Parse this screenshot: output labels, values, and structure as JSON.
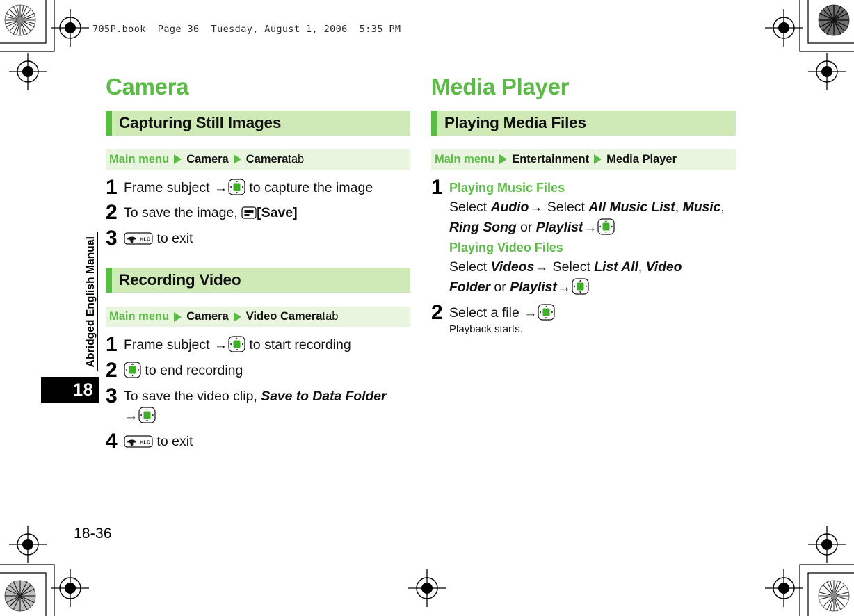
{
  "file_header": "705P.book  Page 36  Tuesday, August 1, 2006  5:35 PM",
  "sidebar": {
    "manual_label": "Abridged English Manual",
    "chapter_number": "18"
  },
  "folio": "18-36",
  "colors": {
    "accent_green": "#5cbb46",
    "band_green": "#cfeab7",
    "path_green": "#e9f5de"
  },
  "columns": [
    {
      "chapter_title": "Camera",
      "sections": [
        {
          "heading": "Capturing Still Images",
          "menu_path": {
            "root": "Main menu",
            "items": [
              "Camera",
              "Camera"
            ],
            "suffix": " tab"
          },
          "steps": [
            {
              "num": "1",
              "parts": [
                {
                  "type": "text",
                  "value": "Frame subject "
                },
                {
                  "type": "arrow",
                  "value": "→"
                },
                {
                  "type": "icon",
                  "icon": "nav-key-icon"
                },
                {
                  "type": "text",
                  "value": " to capture the image"
                }
              ]
            },
            {
              "num": "2",
              "parts": [
                {
                  "type": "text",
                  "value": "To save the image, "
                },
                {
                  "type": "icon",
                  "icon": "soft-key-icon"
                },
                {
                  "type": "bold",
                  "value": "[Save]"
                }
              ]
            },
            {
              "num": "3",
              "parts": [
                {
                  "type": "icon",
                  "icon": "end-hld-key-icon"
                },
                {
                  "type": "text",
                  "value": " to exit"
                }
              ]
            }
          ]
        },
        {
          "heading": "Recording Video",
          "menu_path": {
            "root": "Main menu",
            "items": [
              "Camera",
              "Video Camera"
            ],
            "suffix": " tab"
          },
          "steps": [
            {
              "num": "1",
              "parts": [
                {
                  "type": "text",
                  "value": "Frame subject "
                },
                {
                  "type": "arrow",
                  "value": "→"
                },
                {
                  "type": "icon",
                  "icon": "nav-key-icon"
                },
                {
                  "type": "text",
                  "value": " to start recording"
                }
              ]
            },
            {
              "num": "2",
              "parts": [
                {
                  "type": "icon",
                  "icon": "nav-key-icon"
                },
                {
                  "type": "text",
                  "value": " to end recording"
                }
              ]
            },
            {
              "num": "3",
              "parts": [
                {
                  "type": "text",
                  "value": "To save the video clip, "
                },
                {
                  "type": "italic",
                  "value": "Save to Data Folder"
                },
                {
                  "type": "break"
                },
                {
                  "type": "arrow",
                  "value": "→"
                },
                {
                  "type": "icon",
                  "icon": "nav-key-icon"
                }
              ]
            },
            {
              "num": "4",
              "parts": [
                {
                  "type": "icon",
                  "icon": "end-hld-key-icon"
                },
                {
                  "type": "text",
                  "value": " to exit"
                }
              ]
            }
          ]
        }
      ]
    },
    {
      "chapter_title": "Media Player",
      "sections": [
        {
          "heading": "Playing Media Files",
          "menu_path": {
            "root": "Main menu",
            "items": [
              "Entertainment",
              "Media Player"
            ],
            "suffix": ""
          },
          "steps": [
            {
              "num": "1",
              "parts": [
                {
                  "type": "green-sub",
                  "value": "Playing Music Files"
                },
                {
                  "type": "break"
                },
                {
                  "type": "text",
                  "value": "Select "
                },
                {
                  "type": "italic",
                  "value": "Audio"
                },
                {
                  "type": "arrow",
                  "value": "→"
                },
                {
                  "type": "text",
                  "value": " Select "
                },
                {
                  "type": "italic",
                  "value": "All Music List"
                },
                {
                  "type": "text",
                  "value": ", "
                },
                {
                  "type": "italic",
                  "value": "Music"
                },
                {
                  "type": "text",
                  "value": ","
                },
                {
                  "type": "break"
                },
                {
                  "type": "italic",
                  "value": "Ring Song"
                },
                {
                  "type": "text",
                  "value": " or "
                },
                {
                  "type": "italic",
                  "value": "Playlist"
                },
                {
                  "type": "arrow",
                  "value": "→"
                },
                {
                  "type": "icon",
                  "icon": "nav-key-icon"
                },
                {
                  "type": "break"
                },
                {
                  "type": "green-sub",
                  "value": "Playing Video Files"
                },
                {
                  "type": "break"
                },
                {
                  "type": "text",
                  "value": "Select "
                },
                {
                  "type": "italic",
                  "value": "Videos"
                },
                {
                  "type": "arrow",
                  "value": "→"
                },
                {
                  "type": "text",
                  "value": " Select "
                },
                {
                  "type": "italic",
                  "value": "List All"
                },
                {
                  "type": "text",
                  "value": ", "
                },
                {
                  "type": "italic",
                  "value": "Video"
                },
                {
                  "type": "break"
                },
                {
                  "type": "italic",
                  "value": "Folder"
                },
                {
                  "type": "text",
                  "value": " or "
                },
                {
                  "type": "italic",
                  "value": "Playlist"
                },
                {
                  "type": "arrow",
                  "value": "→"
                },
                {
                  "type": "icon",
                  "icon": "nav-key-icon"
                }
              ]
            },
            {
              "num": "2",
              "parts": [
                {
                  "type": "text",
                  "value": "Select a file "
                },
                {
                  "type": "arrow",
                  "value": "→"
                },
                {
                  "type": "icon",
                  "icon": "nav-key-icon"
                }
              ],
              "sub": "Playback starts."
            }
          ]
        }
      ]
    }
  ]
}
